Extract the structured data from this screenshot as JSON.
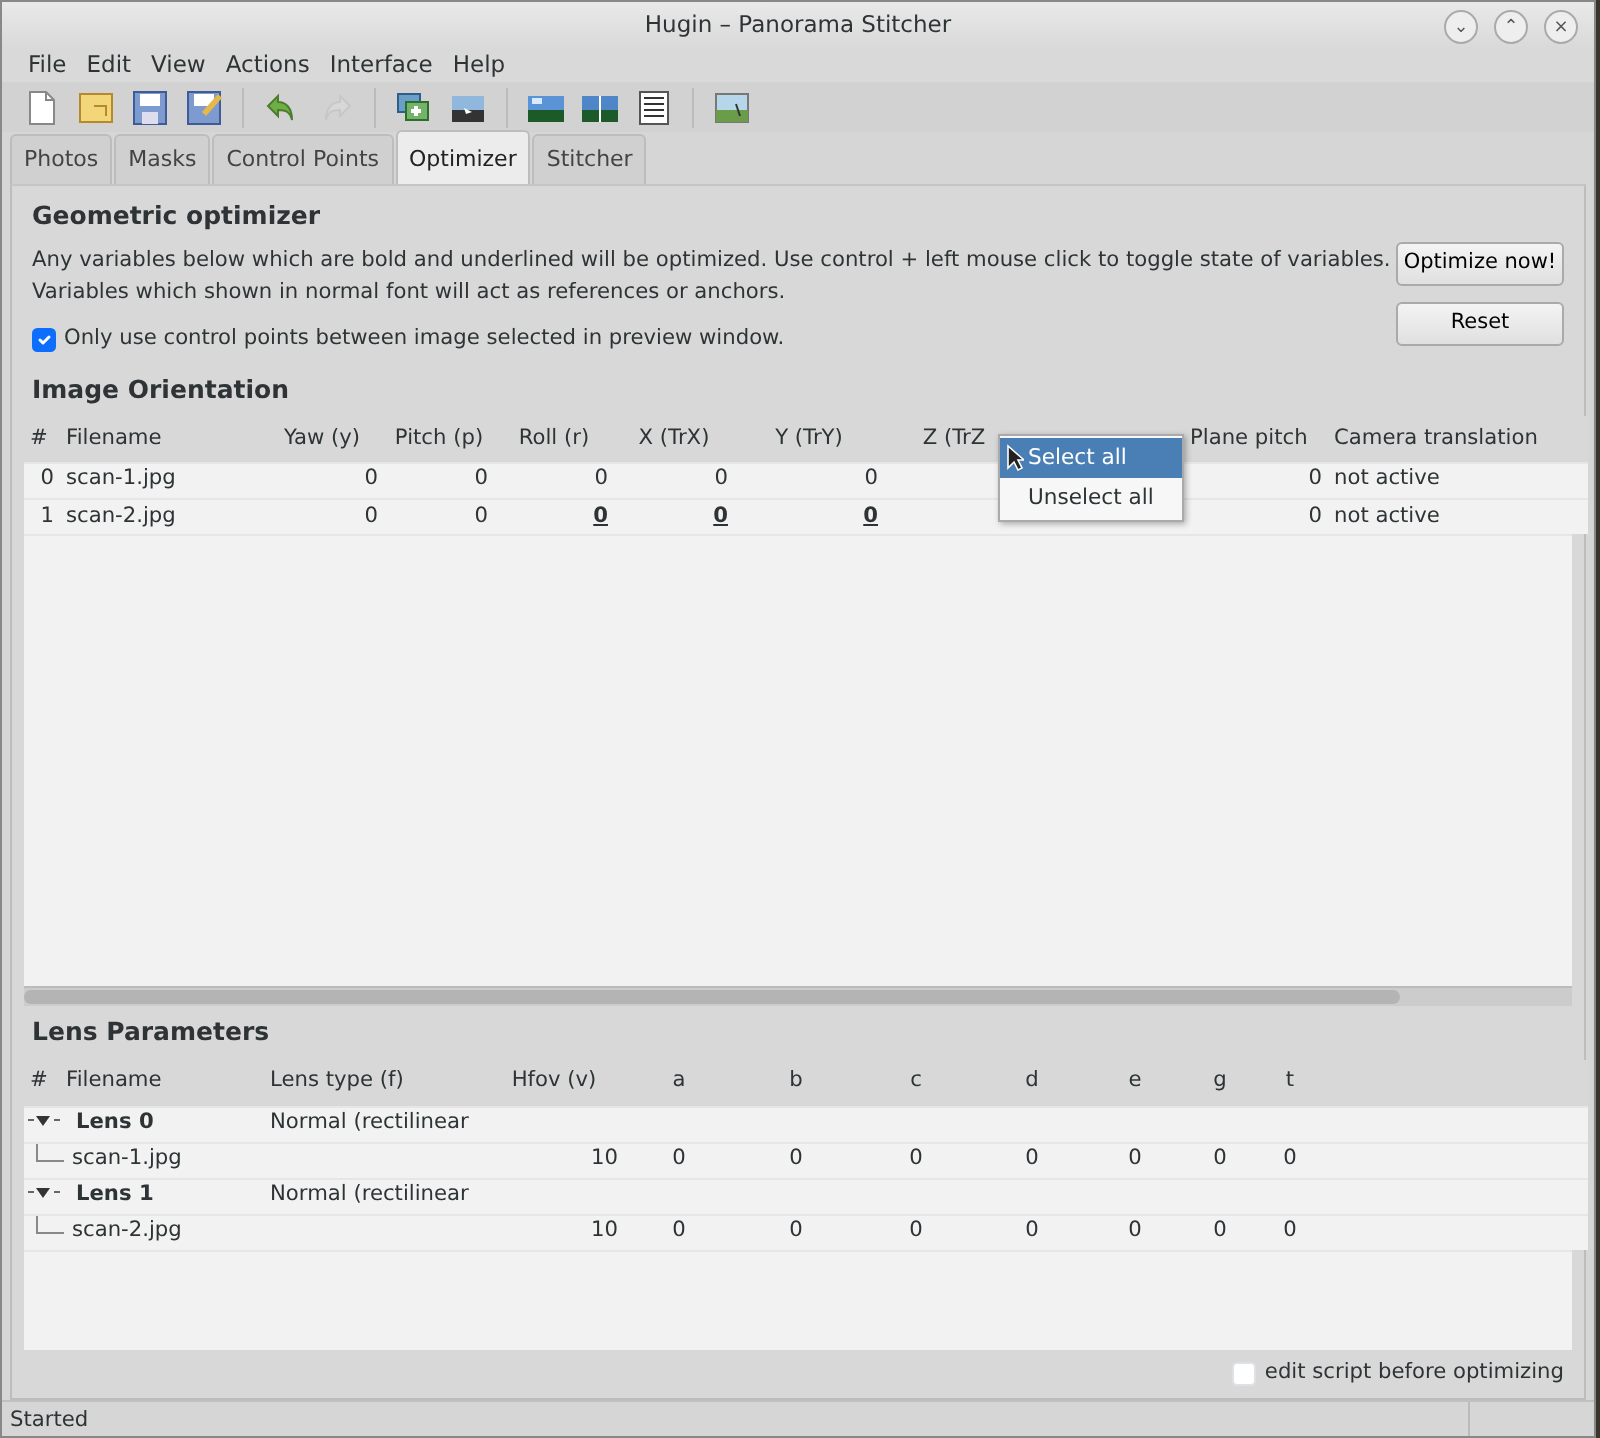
{
  "window": {
    "title": "Hugin – Panorama Stitcher",
    "controls": [
      "⌄",
      "⌃",
      "×"
    ]
  },
  "menu": [
    "File",
    "Edit",
    "View",
    "Actions",
    "Interface",
    "Help"
  ],
  "toolbar": [
    {
      "kind": "new",
      "disabled": false
    },
    {
      "kind": "open",
      "disabled": false
    },
    {
      "kind": "save",
      "disabled": false
    },
    {
      "kind": "saveas",
      "disabled": false
    },
    {
      "kind": "sep"
    },
    {
      "kind": "undo",
      "disabled": false
    },
    {
      "kind": "redo",
      "disabled": true
    },
    {
      "kind": "sep"
    },
    {
      "kind": "add",
      "disabled": false
    },
    {
      "kind": "images",
      "disabled": false
    },
    {
      "kind": "sep"
    },
    {
      "kind": "gl",
      "disabled": false
    },
    {
      "kind": "preview",
      "disabled": false
    },
    {
      "kind": "list",
      "disabled": false
    },
    {
      "kind": "sep"
    },
    {
      "kind": "pano",
      "disabled": false
    }
  ],
  "tabs": [
    {
      "label": "Photos",
      "selected": false
    },
    {
      "label": "Masks",
      "selected": false
    },
    {
      "label": "Control Points",
      "selected": false
    },
    {
      "label": "Optimizer",
      "selected": true
    },
    {
      "label": "Stitcher",
      "selected": false
    }
  ],
  "optimizer": {
    "title": "Geometric optimizer",
    "description": "Any variables below which are bold and underlined will be optimized. Use control + left mouse click to toggle state of variables. Variables which shown in normal font will act as references or anchors.",
    "only_selected": {
      "label": "Only use control points between image selected in preview window.",
      "checked": true
    },
    "buttons": [
      "Optimize now!",
      "Reset"
    ]
  },
  "image_orientation": {
    "title": "Image Orientation",
    "columns": [
      "#",
      "Filename",
      "Yaw (y)",
      "Pitch (p)",
      "Roll (r)",
      "X (TrX)",
      "Y (TrY)",
      "Z (TrZ",
      "",
      "Plane pitch",
      "Camera translation"
    ],
    "rows": [
      {
        "index": "0",
        "filename": "scan-1.jpg",
        "values": [
          {
            "text": "0",
            "optimized": false
          },
          {
            "text": "0",
            "optimized": false
          },
          {
            "text": "0",
            "optimized": false
          },
          {
            "text": "0",
            "optimized": false
          },
          {
            "text": "0",
            "optimized": false
          }
        ],
        "plane_pitch": "0",
        "translation": "not active"
      },
      {
        "index": "1",
        "filename": "scan-2.jpg",
        "values": [
          {
            "text": "0",
            "optimized": false
          },
          {
            "text": "0",
            "optimized": false
          },
          {
            "text": "0",
            "optimized": true
          },
          {
            "text": "0",
            "optimized": true
          },
          {
            "text": "0",
            "optimized": true
          }
        ],
        "plane_pitch": "0",
        "translation": "not active"
      }
    ],
    "context_menu": [
      {
        "label": "Select all",
        "selected": true
      },
      {
        "label": "Unselect all",
        "selected": false
      }
    ]
  },
  "lens_parameters": {
    "title": "Lens Parameters",
    "columns": [
      "#",
      "Filename",
      "Lens type (f)",
      "Hfov (v)",
      "a",
      "b",
      "c",
      "d",
      "e",
      "g",
      "t"
    ],
    "lenses": [
      {
        "name": "Lens 0",
        "lens_type": "Normal (rectilinear",
        "expanded": true,
        "children": [
          {
            "filename": "scan-1.jpg",
            "values": [
              "10",
              "0",
              "0",
              "0",
              "0",
              "0",
              "0",
              "0"
            ]
          }
        ]
      },
      {
        "name": "Lens 1",
        "lens_type": "Normal (rectilinear",
        "expanded": true,
        "children": [
          {
            "filename": "scan-2.jpg",
            "values": [
              "10",
              "0",
              "0",
              "0",
              "0",
              "0",
              "0",
              "0"
            ]
          }
        ]
      }
    ]
  },
  "edit_script": {
    "label": "edit script before optimizing",
    "checked": false
  },
  "status_bar": "Started"
}
